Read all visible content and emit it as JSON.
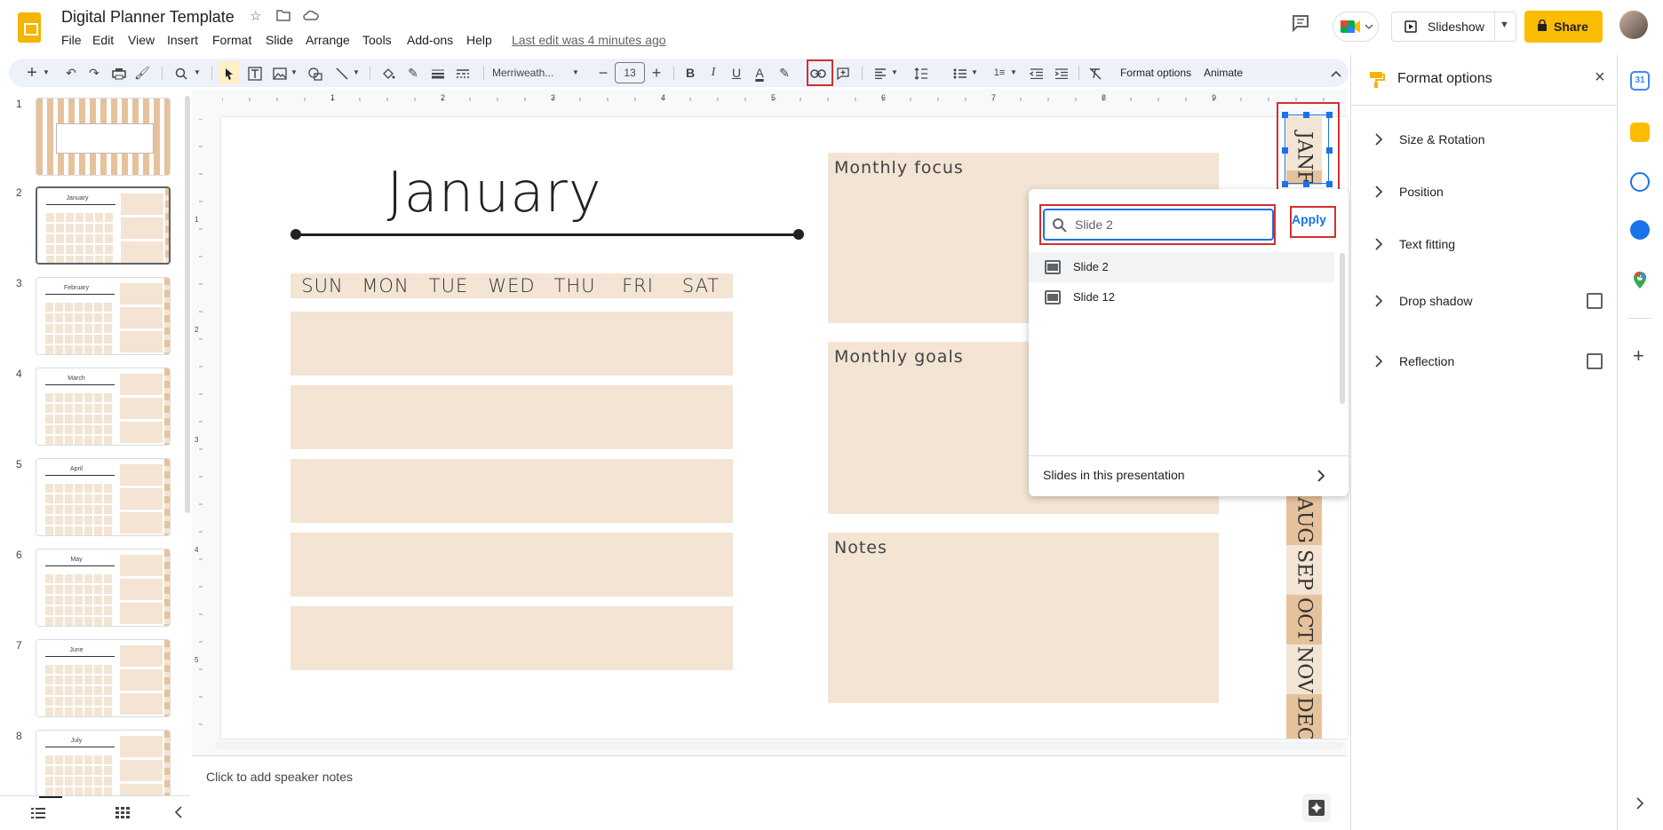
{
  "app": {
    "title": "Digital Planner Template",
    "last_edit": "Last edit was 4 minutes ago"
  },
  "menus": [
    "File",
    "Edit",
    "View",
    "Insert",
    "Format",
    "Slide",
    "Arrange",
    "Tools",
    "Add-ons",
    "Help"
  ],
  "header": {
    "slideshow_label": "Slideshow",
    "share_label": "Share"
  },
  "toolbar": {
    "font": "Merriweath...",
    "font_size": "13",
    "format_options": "Format options",
    "animate": "Animate"
  },
  "filmstrip": {
    "numbers": [
      "1",
      "2",
      "3",
      "4",
      "5",
      "6",
      "7",
      "8"
    ],
    "titles": [
      "",
      "January",
      "February",
      "March",
      "April",
      "May",
      "June",
      "July"
    ]
  },
  "slide": {
    "title": "January",
    "days": [
      "SUN",
      "MON",
      "TUE",
      "WED",
      "THU",
      "FRI",
      "SAT"
    ],
    "boxes": {
      "focus": "Monthly focus",
      "goals": "Monthly goals",
      "notes": "Notes"
    },
    "tabs": [
      "JAN",
      "F",
      "AUG",
      "SEP",
      "OCT",
      "NOV",
      "DEC"
    ]
  },
  "link_popup": {
    "search_placeholder": "Slide 2",
    "search_value": "Slide 2",
    "apply_label": "Apply",
    "results": [
      "Slide 2",
      "Slide 12"
    ],
    "footer": "Slides in this presentation"
  },
  "format_panel": {
    "title": "Format options",
    "sections": [
      "Size & Rotation",
      "Position",
      "Text fitting",
      "Drop shadow",
      "Reflection"
    ]
  },
  "notes": {
    "placeholder": "Click to add speaker notes"
  },
  "ruler": {
    "h": [
      "1",
      "2",
      "3",
      "4",
      "5",
      "6",
      "7",
      "8",
      "9"
    ],
    "v": [
      "1",
      "2",
      "3",
      "4",
      "5"
    ]
  },
  "colors": {
    "accent": "#fbbc04",
    "cell": "#f3e4d4",
    "tab_dark": "#e6c29c",
    "highlight": "#d32f2f",
    "selection": "#1a73e8"
  }
}
